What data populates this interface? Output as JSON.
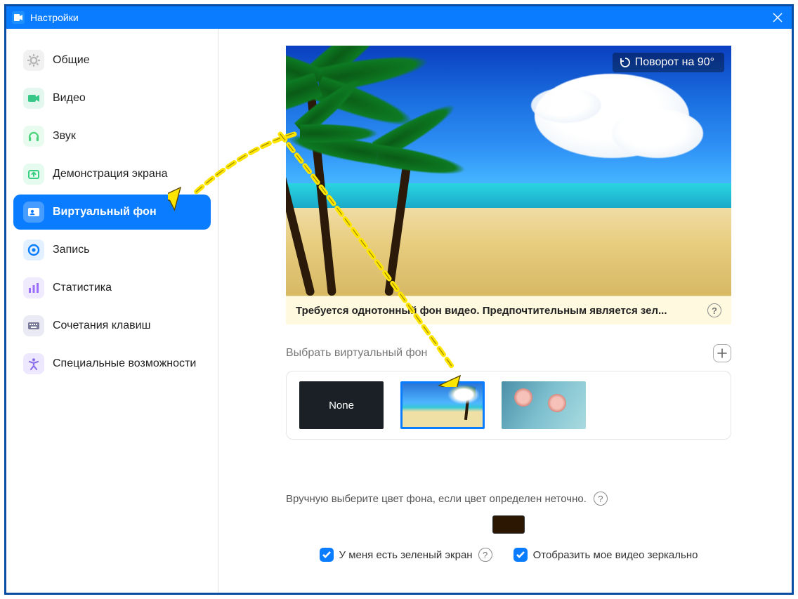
{
  "window": {
    "title": "Настройки"
  },
  "sidebar": {
    "items": [
      {
        "label": "Общие",
        "icon": "gear",
        "bg": "#f1f1f1",
        "fg": "#b8b8b8"
      },
      {
        "label": "Видео",
        "icon": "camera",
        "bg": "#e4f7ee",
        "fg": "#37c887"
      },
      {
        "label": "Звук",
        "icon": "headphones",
        "bg": "#e8fbee",
        "fg": "#49d27c"
      },
      {
        "label": "Демонстрация экрана",
        "icon": "share",
        "bg": "#e6fbef",
        "fg": "#39ce84"
      },
      {
        "label": "Виртуальный фон",
        "icon": "contact",
        "bg": "#ffffff",
        "fg": "#ffffff",
        "selected": true
      },
      {
        "label": "Запись",
        "icon": "record",
        "bg": "#e3f0ff",
        "fg": "#0a7cff"
      },
      {
        "label": "Статистика",
        "icon": "chart",
        "bg": "#f0eaff",
        "fg": "#9b6ff7"
      },
      {
        "label": "Сочетания клавиш",
        "icon": "keyboard",
        "bg": "#eaeaf5",
        "fg": "#7a7a99"
      },
      {
        "label": "Специальные возможности",
        "icon": "accessibility",
        "bg": "#ede8ff",
        "fg": "#8a6fe6"
      }
    ]
  },
  "preview": {
    "rotate_label": "Поворот на 90°"
  },
  "warning": {
    "text": "Требуется однотонный фон видео. Предпочтительным является зел..."
  },
  "select_bg": {
    "header": "Выбрать виртуальный фон",
    "none_label": "None"
  },
  "manual_color": {
    "text": "Вручную выберите цвет фона, если цвет определен неточно.",
    "swatch": "#2b1702"
  },
  "checks": {
    "green_screen": "У меня есть зеленый экран",
    "mirror": "Отобразить мое видео зеркально"
  }
}
